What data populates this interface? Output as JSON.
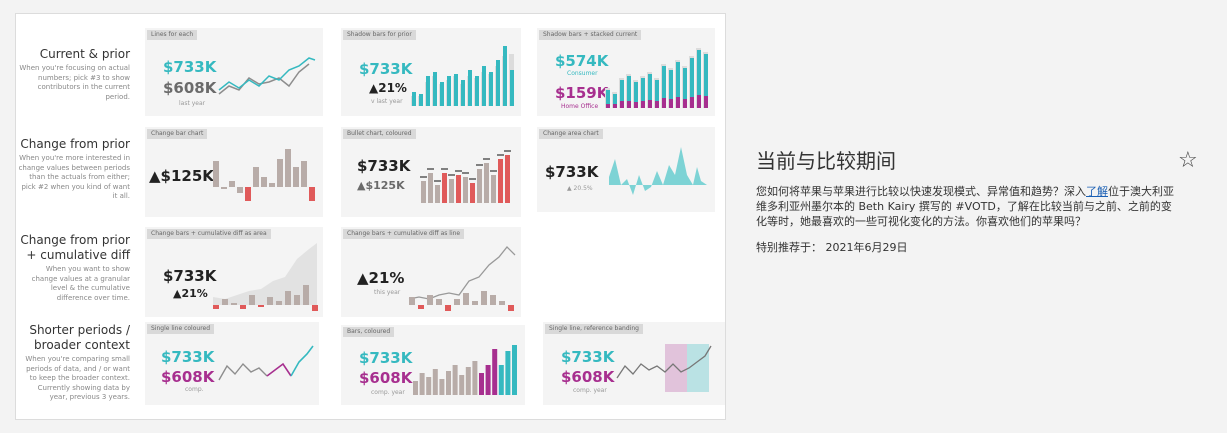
{
  "rows": [
    {
      "title": "Current & prior",
      "desc": "When you're focusing on actual numbers; pick #3 to show contributors in the current period."
    },
    {
      "title": "Change from prior",
      "desc": "When you're more interested in change values between periods than the actuals from either; pick #2 when you kind of want it all."
    },
    {
      "title": "Change from prior + cumulative diff",
      "desc": "When you want to show change values at a granular level & the cumulative difference over time."
    },
    {
      "title": "Shorter periods / broader context",
      "desc": "When you're comparing small periods of data, and / or want to keep the broader context. Currently showing data by year, previous 3 years."
    }
  ],
  "tiles": {
    "t11": {
      "tag": "Lines for each",
      "v1": "$733K",
      "v2": "$608K",
      "sub": "last year"
    },
    "t12": {
      "tag": "Shadow bars for prior",
      "v1": "$733K",
      "v2": "▲21%",
      "sub": "v last year"
    },
    "t13": {
      "tag": "Shadow bars + stacked current",
      "v1": "$574K",
      "l1": "Consumer",
      "v2": "$159K",
      "l2": "Home Office"
    },
    "t21": {
      "tag": "Change bar chart",
      "v1": "▲$125K"
    },
    "t22": {
      "tag": "Bullet chart, coloured",
      "v1": "$733K",
      "v2": "▲$125K"
    },
    "t23": {
      "tag": "Change area chart",
      "v1": "$733K",
      "v2": "▲ 20.5%"
    },
    "t31": {
      "tag": "Change bars + cumulative diff as area",
      "v1": "$733K",
      "v2": "▲21%"
    },
    "t32": {
      "tag": "Change bars + cumulative diff as line",
      "v1": "▲21%",
      "sub": "this year"
    },
    "t41": {
      "tag": "Single line coloured",
      "v1": "$733K",
      "v2": "$608K",
      "sub": "comp."
    },
    "t42": {
      "tag": "Bars, coloured",
      "v1": "$733K",
      "v2": "$608K",
      "sub": "comp. year"
    },
    "t43": {
      "tag": "Single line, reference banding",
      "v1": "$733K",
      "v2": "$608K",
      "sub": "comp. year"
    }
  },
  "colors": {
    "teal": "#35b9c0",
    "grey": "#b8aca8",
    "red": "#e05a5a",
    "magenta": "#a72f8f"
  },
  "side": {
    "title": "当前与比较期间",
    "desc_before": "您如何将苹果与苹果进行比较以快速发现模式、异常值和趋势？深入",
    "desc_link": "了解",
    "desc_after": "位于澳大利亚维多利亚州墨尔本的 Beth Kairy 撰写的 #VOTD，了解在比较当前与之前、之前的变化等时，她最喜欢的一些可视化变化的方法。你喜欢他们的苹果吗？",
    "featured": "特别推荐于：  2021年6月29日"
  },
  "favorite_icon": "star-outline-icon"
}
